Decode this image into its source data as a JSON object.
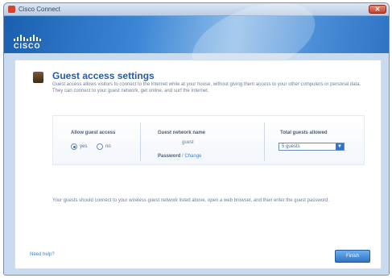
{
  "window": {
    "title": "Cisco Connect"
  },
  "brand": {
    "logo_text": "CISCO"
  },
  "page": {
    "heading": "Guest access settings",
    "description": "Guest access allows visitors to connect to the Internet while at your house, without giving them access to your other computers or personal data. They can connect to your guest network, get online, and surf the Internet.",
    "allow_guest": {
      "label": "Allow guest access",
      "options": [
        {
          "label": "yes",
          "selected": true
        },
        {
          "label": "no",
          "selected": false
        }
      ]
    },
    "guest_network": {
      "label": "Guest network name",
      "name_value": "guest",
      "password_label": "Password",
      "separator": "/",
      "change_link": "Change"
    },
    "total_guests": {
      "label": "Total guests allowed",
      "selected": "5 guests"
    },
    "instruction": "Your guests should connect to your wireless guest network listed above, open a web browser, and then enter the guest password.",
    "help_link": "Need help?",
    "finish_button": "Finish"
  },
  "colors": {
    "accent": "#2a5c9e",
    "link": "#3a82d6",
    "banner": "#3c86d6"
  }
}
